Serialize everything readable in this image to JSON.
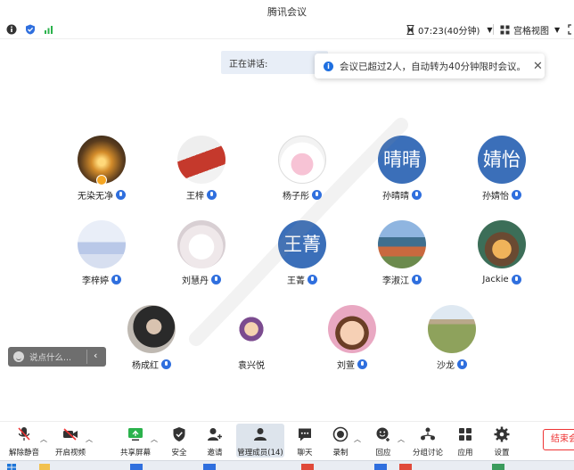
{
  "window": {
    "title": "腾讯会议"
  },
  "status": {
    "timer_text": "07:23(40分钟)",
    "view_label": "宫格视图",
    "icons": [
      "info-icon",
      "shield-icon",
      "signal-icon",
      "hourglass-icon",
      "grid-icon",
      "fullscreen-icon"
    ]
  },
  "speaking": {
    "label": "正在讲话:"
  },
  "toast": {
    "message": "会议已超过2人，自动转为40分钟限时会议。"
  },
  "participants": [
    {
      "name": "无染无净",
      "type": "photo",
      "host": true
    },
    {
      "name": "王梓",
      "type": "photo"
    },
    {
      "name": "杨子彤",
      "type": "photo"
    },
    {
      "name": "孙晴晴",
      "type": "text",
      "initials": "晴晴"
    },
    {
      "name": "孙婧怡",
      "type": "text",
      "initials": "婧怡"
    },
    {
      "name": "李梓婷",
      "type": "photo"
    },
    {
      "name": "刘慧丹",
      "type": "photo"
    },
    {
      "name": "王菁",
      "type": "text",
      "initials": "王菁"
    },
    {
      "name": "李淑江",
      "type": "photo"
    },
    {
      "name": "Jackie",
      "type": "photo"
    },
    {
      "name": "杨成红",
      "type": "photo"
    },
    {
      "name": "袁兴悦",
      "type": "photo"
    },
    {
      "name": "刘萱",
      "type": "photo"
    },
    {
      "name": "沙龙",
      "type": "photo"
    }
  ],
  "chat": {
    "placeholder": "说点什么..."
  },
  "toolbar": {
    "unmute": "解除静音",
    "video": "开启视频",
    "share": "共享屏幕",
    "security": "安全",
    "invite": "邀请",
    "members": "管理成员(14)",
    "chat": "聊天",
    "record": "录制",
    "reaction": "回应",
    "breakout": "分组讨论",
    "apps": "应用",
    "settings": "设置",
    "end": "结束会议"
  },
  "colors": {
    "accent": "#2f6fde",
    "avatar_blue": "#3b6fb9",
    "end_red": "#e33333"
  }
}
